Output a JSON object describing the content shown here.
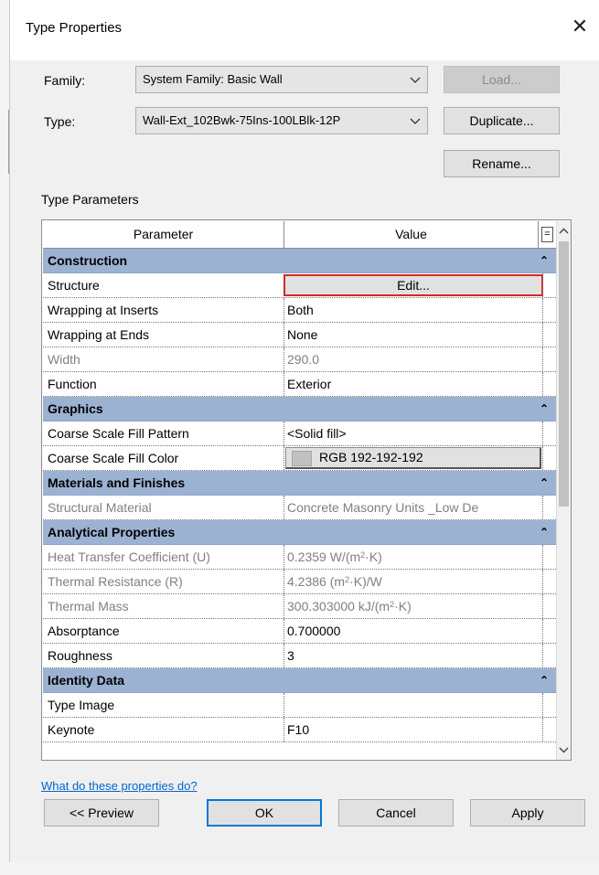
{
  "dialog": {
    "title": "Type Properties",
    "close_glyph": "✕"
  },
  "family": {
    "label": "Family:",
    "value": "System Family: Basic Wall"
  },
  "type": {
    "label": "Type:",
    "value": "Wall-Ext_102Bwk-75Ins-100LBlk-12P"
  },
  "buttons": {
    "load": "Load...",
    "duplicate": "Duplicate...",
    "rename": "Rename..."
  },
  "section_label": "Type Parameters",
  "grid": {
    "header_parameter": "Parameter",
    "header_value": "Value",
    "header_eq": "=",
    "groups": {
      "construction": "Construction",
      "graphics": "Graphics",
      "materials": "Materials and Finishes",
      "analytical": "Analytical Properties",
      "identity": "Identity Data"
    },
    "collapse_glyph": "⌃",
    "params": {
      "structure": {
        "name": "Structure",
        "value": "Edit..."
      },
      "wrap_inserts": {
        "name": "Wrapping at Inserts",
        "value": "Both"
      },
      "wrap_ends": {
        "name": "Wrapping at Ends",
        "value": "None"
      },
      "width": {
        "name": "Width",
        "value": "290.0"
      },
      "function": {
        "name": "Function",
        "value": "Exterior"
      },
      "fill_pattern": {
        "name": "Coarse Scale Fill Pattern",
        "value": "<Solid fill>"
      },
      "fill_color": {
        "name": "Coarse Scale Fill Color",
        "value": "RGB 192-192-192",
        "swatch": "#c0c0c0"
      },
      "struct_material": {
        "name": "Structural Material",
        "value": "Concrete Masonry Units _Low De"
      },
      "heat_transfer": {
        "name": "Heat Transfer Coefficient (U)",
        "value_pre": "0.2359 W/(m",
        "value_sup": "2",
        "value_post": "·K)"
      },
      "thermal_res": {
        "name": "Thermal Resistance (R)",
        "value_pre": "4.2386 (m",
        "value_sup": "2",
        "value_post": "·K)/W"
      },
      "thermal_mass": {
        "name": "Thermal Mass",
        "value_pre": "300.303000 kJ/(m",
        "value_sup": "2",
        "value_post": "·K)"
      },
      "absorptance": {
        "name": "Absorptance",
        "value": "0.700000"
      },
      "roughness": {
        "name": "Roughness",
        "value": "3"
      },
      "type_image": {
        "name": "Type Image",
        "value": ""
      },
      "keynote": {
        "name": "Keynote",
        "value": "F10"
      }
    }
  },
  "help_link": "What do these properties do?",
  "footer": {
    "preview": "<< Preview",
    "ok": "OK",
    "cancel": "Cancel",
    "apply": "Apply"
  }
}
